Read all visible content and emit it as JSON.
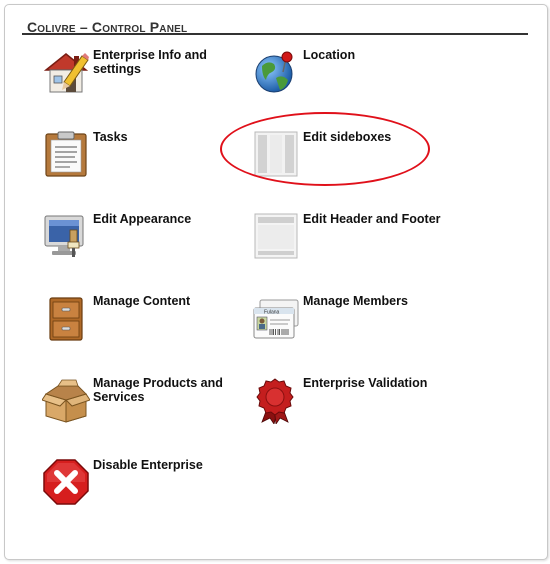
{
  "panel": {
    "title_prefix": "Colivre",
    "title_sep": " – ",
    "title_suffix": "Control Panel"
  },
  "items": [
    {
      "label": "Enterprise Info and settings",
      "icon": "house-pencil-icon"
    },
    {
      "label": "Location",
      "icon": "globe-pin-icon"
    },
    {
      "label": "Tasks",
      "icon": "clipboard-icon"
    },
    {
      "label": "Edit sideboxes",
      "icon": "columns-layout-icon"
    },
    {
      "label": "Edit Appearance",
      "icon": "monitor-paint-icon"
    },
    {
      "label": "Edit Header and Footer",
      "icon": "header-footer-layout-icon"
    },
    {
      "label": "Manage Content",
      "icon": "cabinet-icon"
    },
    {
      "label": "Manage Members",
      "icon": "member-cards-icon"
    },
    {
      "label": "Manage Products and Services",
      "icon": "open-box-icon"
    },
    {
      "label": "Enterprise Validation",
      "icon": "seal-ribbon-icon"
    },
    {
      "label": "Disable Enterprise",
      "icon": "red-x-octagon-icon"
    }
  ],
  "member_card_text": "Fulana",
  "colors": {
    "highlight": "#e0101a",
    "rule": "#333333"
  }
}
